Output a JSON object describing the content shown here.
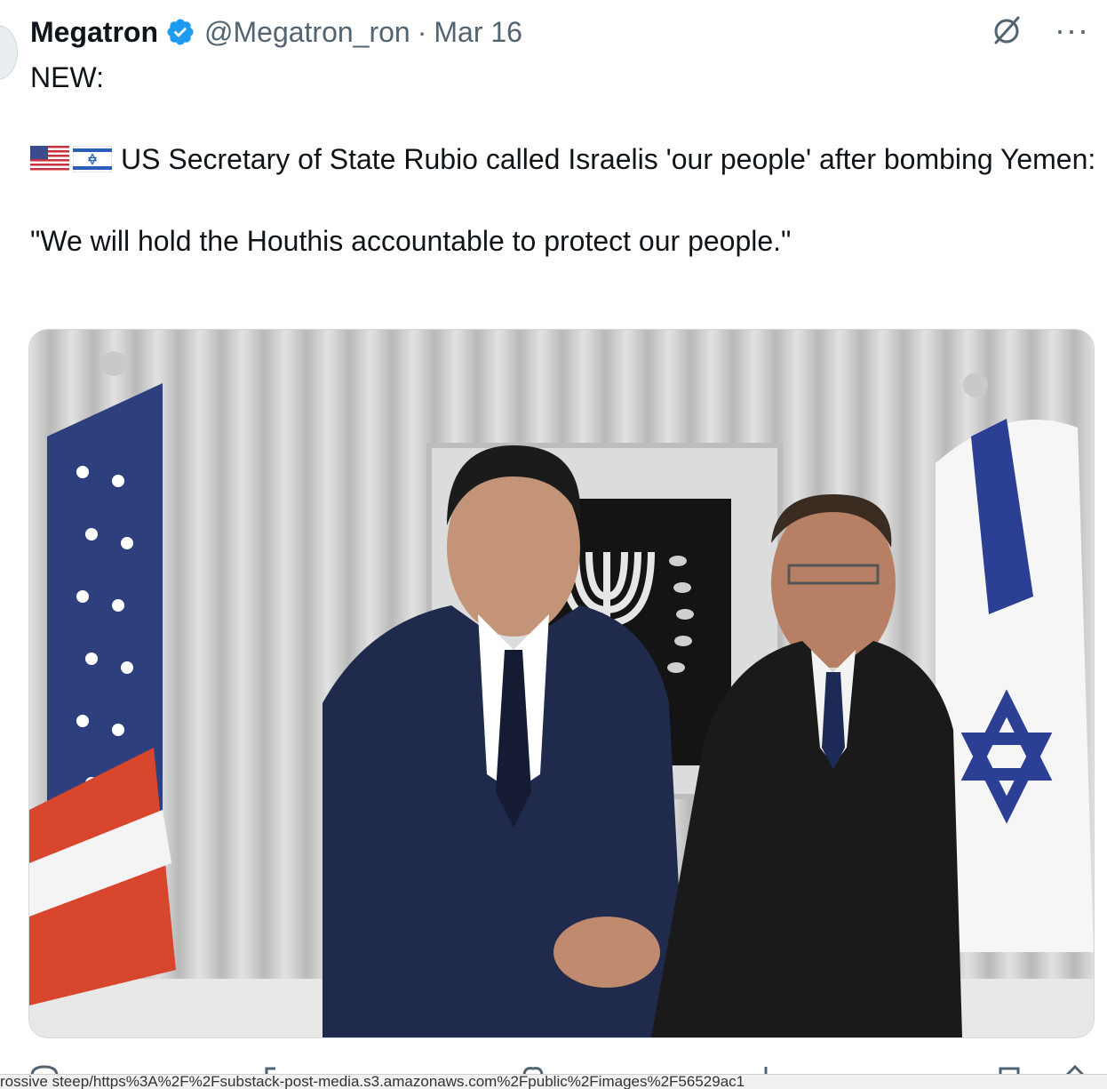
{
  "tweet": {
    "author_name": "Megatron",
    "handle": "@Megatron_ron",
    "separator": "·",
    "date": "Mar 16",
    "text_line1": "NEW:",
    "text_line2": "US Secretary of State Rubio called Israelis 'our people' after bombing Yemen:",
    "text_line3": "\"We will hold the Houthis accountable to protect our people.\"",
    "more_label": "···"
  },
  "status_bar": {
    "url": "rossive steep/https%3A%2F%2Fsubstack-post-media.s3.amazonaws.com%2Fpublic%2Fimages%2F56529ac1"
  },
  "colors": {
    "verified": "#1d9bf0",
    "secondary_text": "#536471"
  },
  "icons": [
    "verified-badge-icon",
    "grok-icon",
    "more-options-icon",
    "us-flag-icon",
    "israel-flag-icon",
    "reply-icon",
    "repost-icon",
    "like-icon",
    "views-icon",
    "bookmark-icon",
    "share-icon"
  ]
}
